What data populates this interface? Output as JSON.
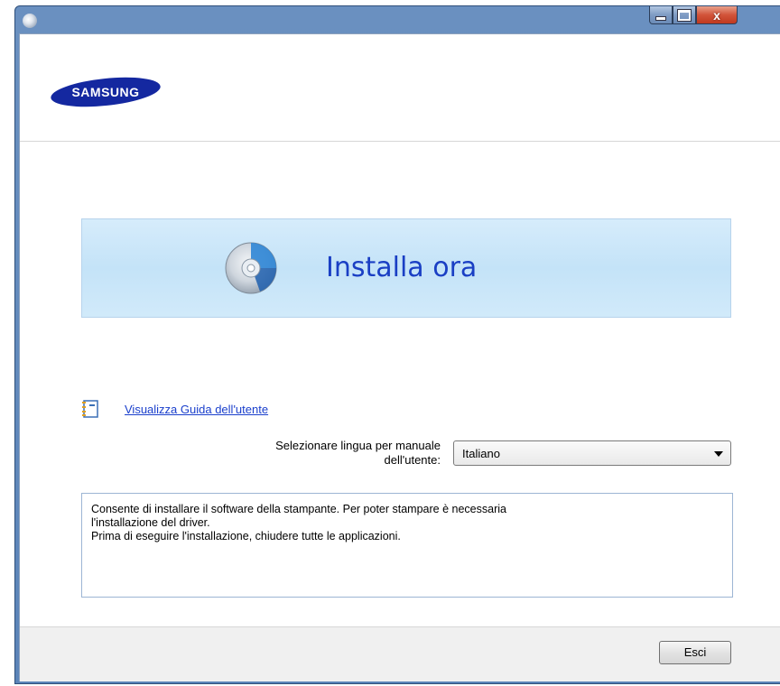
{
  "window": {
    "title": "",
    "controls": {
      "minimize_icon": "minimize-icon",
      "maximize_icon": "maximize-icon",
      "close_icon": "close-icon",
      "close_glyph": "x"
    }
  },
  "brand": {
    "logo_text": "SAMSUNG",
    "logo_color": "#1428a0"
  },
  "install": {
    "label": "Installa ora",
    "icon": "cd-disc-icon"
  },
  "guide": {
    "link_text": "Visualizza Guida dell'utente",
    "icon": "user-guide-icon"
  },
  "language": {
    "label_line1": "Selezionare lingua per manuale",
    "label_line2": "dell'utente:",
    "selected": "Italiano"
  },
  "description": {
    "line1": "Consente di installare il software della stampante. Per poter stampare è necessaria",
    "line2": "l'installazione del driver.",
    "line3": "Prima di eseguire l'installazione, chiudere tutte le applicazioni."
  },
  "footer": {
    "exit_label": "Esci"
  },
  "colors": {
    "link": "#1a3fcc",
    "install_text": "#1a3fc4",
    "banner_bg": "#cfe8fa",
    "titlebar": "#5b84b8"
  }
}
